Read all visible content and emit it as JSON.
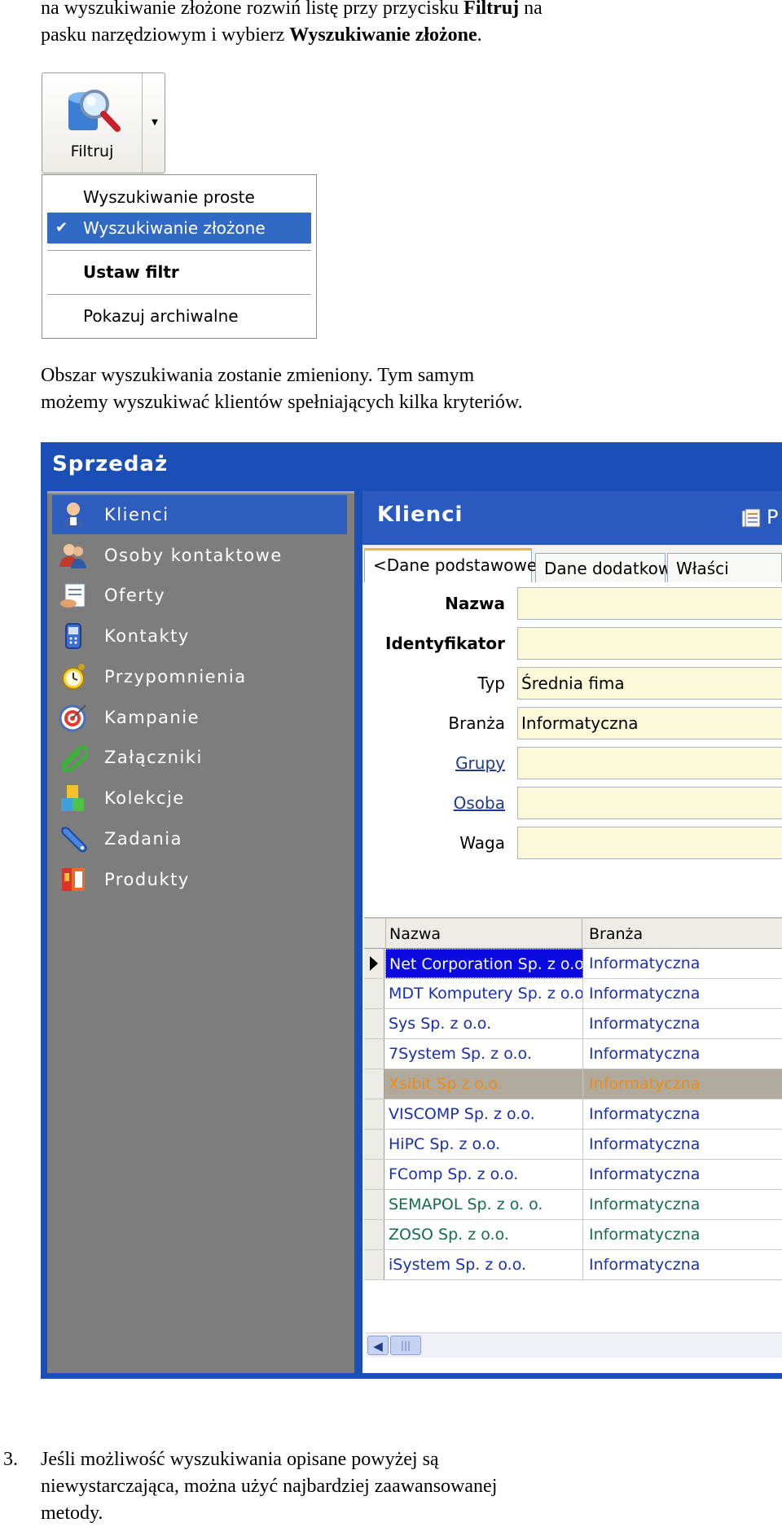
{
  "intro": {
    "line1_a": "na wyszukiwanie złożone rozwiń listę przy przycisku ",
    "line1_b": "Filtruj",
    "line1_c": " na",
    "line2_a": "pasku narzędziowym i wybierz ",
    "line2_b": "Wyszukiwanie złożone",
    "line2_c": "."
  },
  "filter_button": {
    "label": "Filtruj"
  },
  "filter_menu": {
    "items": [
      "Wyszukiwanie proste",
      "Wyszukiwanie złożone",
      "Ustaw filtr",
      "Pokazuj archiwalne"
    ],
    "checked_item": "Wyszukiwanie złożone"
  },
  "para2": {
    "line1": "Obszar wyszukiwania zostanie zmieniony. Tym samym",
    "line2": "możemy wyszukiwać klientów spełniających kilka kryteriów."
  },
  "app": {
    "title": "Sprzedaż",
    "nav": [
      {
        "label": "Klienci",
        "icon": "user-icon"
      },
      {
        "label": "Osoby kontaktowe",
        "icon": "contacts-icon"
      },
      {
        "label": "Oferty",
        "icon": "offers-icon"
      },
      {
        "label": "Kontakty",
        "icon": "phone-icon"
      },
      {
        "label": "Przypomnienia",
        "icon": "alarm-clock-icon"
      },
      {
        "label": "Kampanie",
        "icon": "target-icon"
      },
      {
        "label": "Załączniki",
        "icon": "paperclip-icon"
      },
      {
        "label": "Kolekcje",
        "icon": "blocks-icon"
      },
      {
        "label": "Zadania",
        "icon": "wrench-icon"
      },
      {
        "label": "Produkty",
        "icon": "book-icon"
      }
    ],
    "panel_title": "Klienci",
    "panel_header_right": "P",
    "tabs": [
      "<Dane podstawowe>",
      "Dane dodatkowe",
      "Właści"
    ],
    "form": [
      {
        "label": "Nazwa",
        "value": ""
      },
      {
        "label": "Identyfikator",
        "value": ""
      },
      {
        "label": "Typ",
        "value": "Średnia fima"
      },
      {
        "label": "Branża",
        "value": "Informatyczna"
      },
      {
        "label": "Grupy",
        "value": ""
      },
      {
        "label": "Osoba",
        "value": ""
      },
      {
        "label": "Waga",
        "value": ""
      }
    ],
    "grid": {
      "columns": [
        "Nazwa",
        "Branża"
      ],
      "rows": [
        {
          "name": "Net Corporation Sp. z o.o.",
          "branch": "Informatyczna"
        },
        {
          "name": "MDT Komputery Sp. z o.o.",
          "branch": "Informatyczna"
        },
        {
          "name": "Sys Sp. z o.o.",
          "branch": "Informatyczna"
        },
        {
          "name": "7System Sp. z o.o.",
          "branch": "Informatyczna"
        },
        {
          "name": "Xsibit Sp z o.o.",
          "branch": "Informatyczna"
        },
        {
          "name": "VISCOMP Sp. z o.o.",
          "branch": "Informatyczna"
        },
        {
          "name": "HiPC Sp. z o.o.",
          "branch": "Informatyczna"
        },
        {
          "name": "FComp Sp. z o.o.",
          "branch": "Informatyczna"
        },
        {
          "name": "SEMAPOL Sp. z o. o.",
          "branch": "Informatyczna"
        },
        {
          "name": "ZOSO Sp. z o.o.",
          "branch": "Informatyczna"
        },
        {
          "name": "iSystem Sp. z o.o.",
          "branch": "Informatyczna"
        }
      ]
    }
  },
  "point3": {
    "number": "3.",
    "line1": "Jeśli możliwość wyszukiwania opisane powyżej są",
    "line2": "niewystarczająca, można użyć najbardziej zaawansowanej",
    "line3": "metody."
  }
}
